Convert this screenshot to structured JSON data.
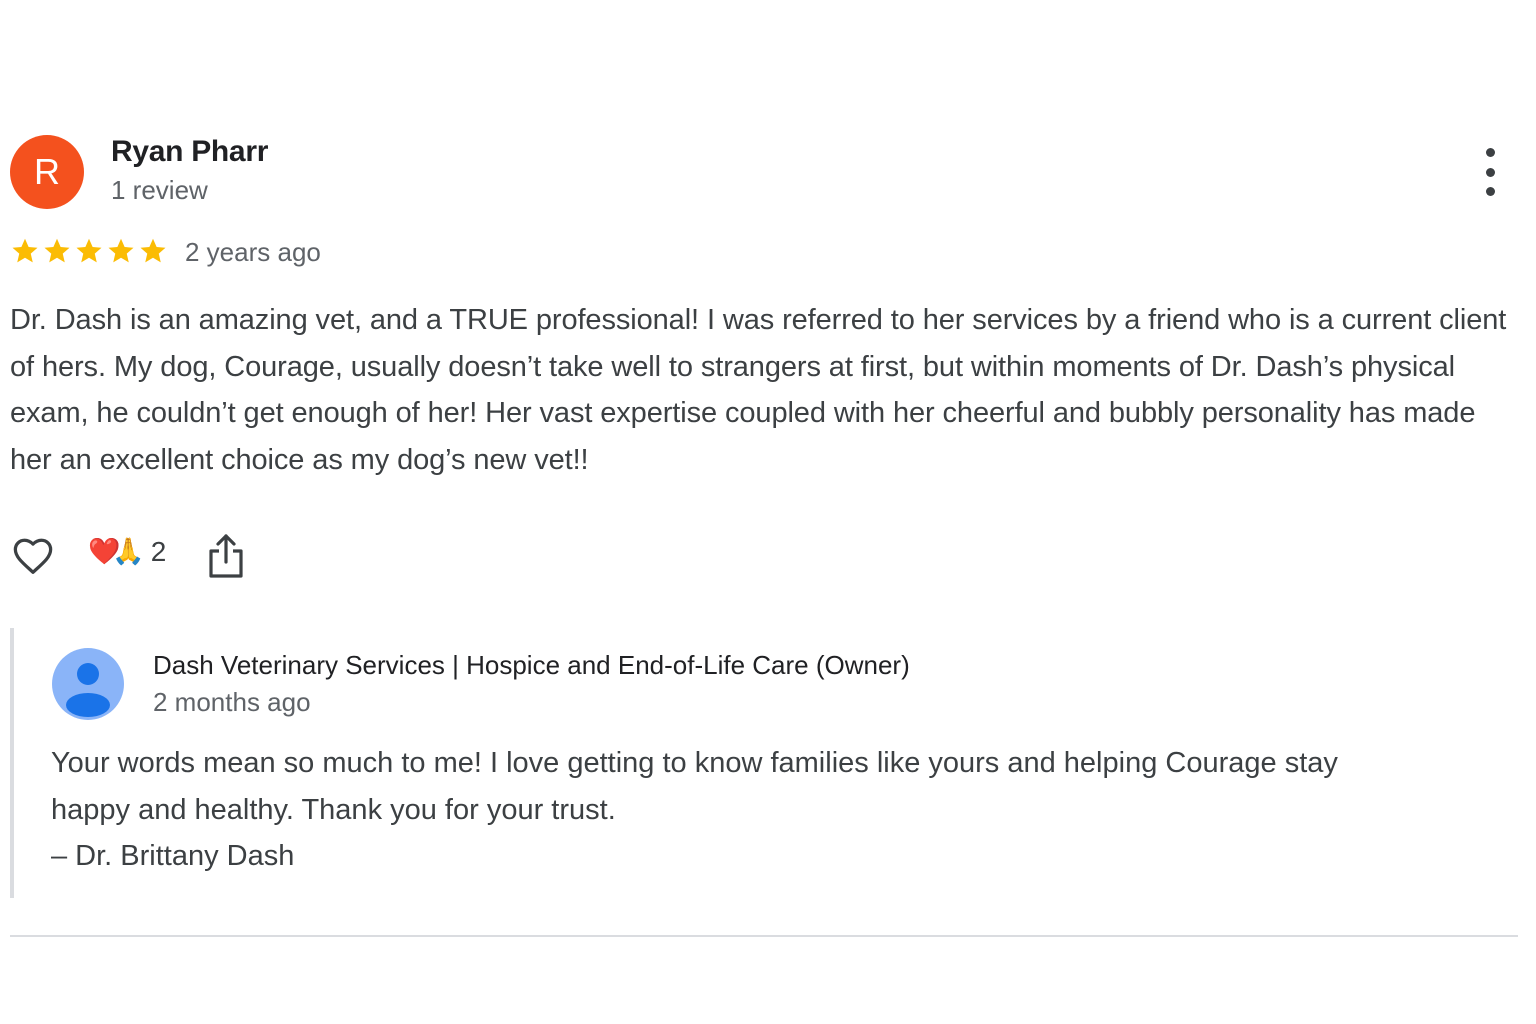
{
  "review": {
    "author": {
      "initial": "R",
      "name": "Ryan Pharr",
      "review_count": "1 review",
      "avatar_color": "#f4511e"
    },
    "rating": 5,
    "max_rating": 5,
    "time": "2 years ago",
    "text": "Dr. Dash is an amazing vet, and a TRUE professional! I was referred to her services by a friend who is a current client of hers. My dog, Courage, usually doesn’t take well to strangers at first, but within moments of Dr. Dash’s physical exam, he couldn’t get enough of her! Her vast expertise coupled with her cheerful and bubbly personality has made her an excellent choice as my dog’s new vet!!",
    "reactions": {
      "emojis": "❤️🙏",
      "count": "2"
    },
    "icons": {
      "more": "more-vert-icon",
      "like": "heart-outline-icon",
      "share": "share-icon"
    },
    "star_color": "#fbbc04"
  },
  "owner_reply": {
    "name": "Dash Veterinary Services | Hospice and End-of-Life Care (Owner)",
    "time": "2 months ago",
    "lines": [
      "Your words mean so much to me! I love getting to know families like yours and helping Courage stay",
      "happy and healthy. Thank you for your trust.",
      "– Dr. Brittany Dash"
    ],
    "avatar_color": "#8ab4f8",
    "avatar_figure_color": "#1a73e8"
  }
}
